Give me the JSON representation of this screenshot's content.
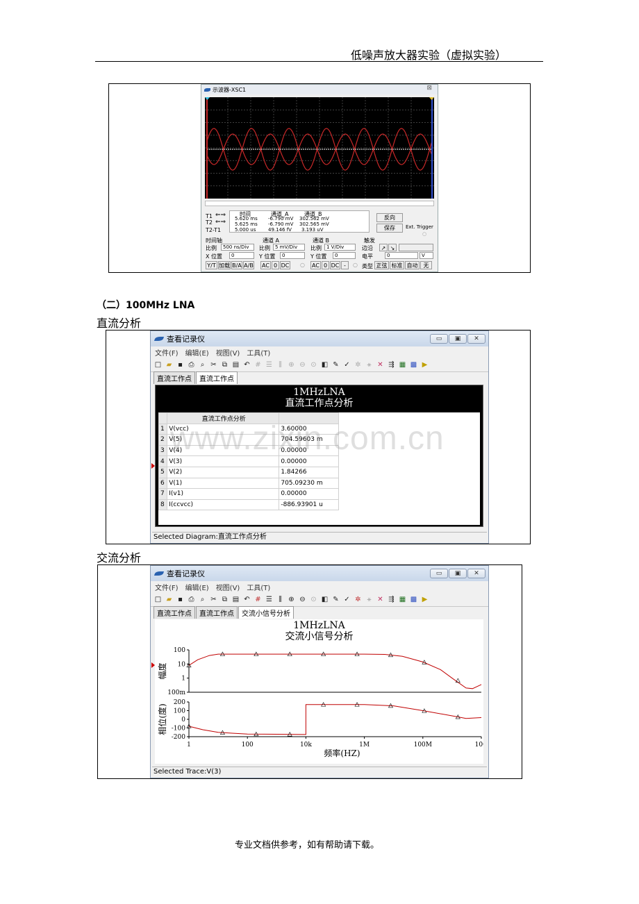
{
  "header": {
    "title": "低噪声放大器实验（虚拟实验）"
  },
  "scope": {
    "title": "示波器-XSC1",
    "close": "⊠",
    "col_headers": [
      "时间",
      "通道_A",
      "通道_B"
    ],
    "rows": [
      {
        "label": "T1",
        "time": "5.620 ms",
        "a": "-6.790 mV",
        "b": "302.562 mV"
      },
      {
        "label": "T2",
        "time": "5.625 ms",
        "a": "-6.790 mV",
        "b": "302.565 mV"
      },
      {
        "label": "T2-T1",
        "time": "5.000 us",
        "a": "49.146 fV",
        "b": "3.193 uV"
      }
    ],
    "reverse": "反向",
    "save": "保存",
    "ext_trigger": "Ext. Trigger",
    "timebase": {
      "title": "时间轴",
      "scale_label": "比例",
      "scale": "500 ns/Div",
      "pos_label": "X 位置",
      "pos": "0",
      "buttons": [
        "Y/T",
        "加载",
        "B/A",
        "A/B"
      ]
    },
    "chA": {
      "title": "通道 A",
      "scale_label": "比例",
      "scale": "5 mV/Div",
      "pos_label": "Y 位置",
      "pos": "0",
      "buttons": [
        "AC",
        "0",
        "DC"
      ]
    },
    "chB": {
      "title": "通道 B",
      "scale_label": "比例",
      "scale": "1 V/Div",
      "pos_label": "Y 位置",
      "pos": "0",
      "buttons": [
        "AC",
        "0",
        "DC",
        "-"
      ]
    },
    "trigger": {
      "title": "触发",
      "edge_label": "边沿",
      "level_label": "电平",
      "level": "0",
      "level_unit": "V",
      "type_label": "类型",
      "buttons": [
        "正弦",
        "标准",
        "自动",
        "无"
      ]
    }
  },
  "section": {
    "title": "（二）100MHz LNA",
    "dc_label": "直流分析",
    "ac_label": "交流分析"
  },
  "grapher": {
    "title": "查看记录仪",
    "menu": [
      "文件(F)",
      "编辑(E)",
      "视图(V)",
      "工具(T)"
    ],
    "min": "▭",
    "max": "▣",
    "close": "✕"
  },
  "dc": {
    "tabs": [
      "直流工作点",
      "直流工作点"
    ],
    "chart_title": "1MHzLNA",
    "chart_sub": "直流工作点分析",
    "col_header": "直流工作点分析",
    "rows": [
      {
        "n": "1",
        "name": "V(vcc)",
        "val": "3.60000"
      },
      {
        "n": "2",
        "name": "V(5)",
        "val": "704.59603 m"
      },
      {
        "n": "3",
        "name": "V(4)",
        "val": "0.00000"
      },
      {
        "n": "4",
        "name": "V(3)",
        "val": "0.00000"
      },
      {
        "n": "5",
        "name": "V(2)",
        "val": "1.84266"
      },
      {
        "n": "6",
        "name": "V(1)",
        "val": "705.09230 m"
      },
      {
        "n": "7",
        "name": "I(v1)",
        "val": "0.00000"
      },
      {
        "n": "8",
        "name": "I(ccvcc)",
        "val": "-886.93901 u"
      }
    ],
    "status": "Selected Diagram:直流工作点分析"
  },
  "ac": {
    "tabs": [
      "直流工作点",
      "直流工作点",
      "交流小信号分析"
    ],
    "chart_title": "1MHzLNA",
    "chart_sub": "交流小信号分析",
    "status": "Selected Trace:V(3)"
  },
  "chart_data": [
    {
      "type": "line",
      "title": "1MHzLNA",
      "subtitle": "交流小信号分析",
      "ylabel": "幅度",
      "xlabel": "频率(HZ)",
      "x_scale": "log",
      "y_scale": "log",
      "x_ticks": [
        "1",
        "100",
        "10k",
        "1M",
        "100M",
        "10G"
      ],
      "y_ticks": [
        "100",
        "10",
        "1",
        "100m"
      ],
      "xlim": [
        1,
        10000000000
      ],
      "ylim": [
        0.1,
        100
      ],
      "color": "#c00000",
      "x": [
        1,
        2,
        5,
        10,
        30,
        100,
        1000,
        10000,
        100000,
        1000000,
        5000000,
        20000000,
        100000000,
        400000000,
        1000000000,
        3000000000,
        5000000000,
        10000000000
      ],
      "y": [
        8,
        20,
        40,
        50,
        50,
        50,
        50,
        50,
        50,
        50,
        48,
        35,
        14,
        4,
        1,
        0.2,
        0.18,
        0.35
      ]
    },
    {
      "type": "line",
      "ylabel": "相位(度)",
      "xlabel": "频率(HZ)",
      "x_scale": "log",
      "y_ticks": [
        "200",
        "100",
        "0",
        "-100",
        "-200"
      ],
      "xlim": [
        1,
        10000000000
      ],
      "ylim": [
        -200,
        200
      ],
      "color": "#c00000",
      "x": [
        1,
        3,
        10,
        30,
        100,
        1000,
        10000,
        10001,
        100000,
        1000000,
        10000000,
        100000000,
        1000000000,
        3000000000,
        10000000000
      ],
      "y": [
        -80,
        -120,
        -150,
        -160,
        -170,
        -172,
        -175,
        170,
        170,
        170,
        155,
        100,
        40,
        10,
        20
      ]
    }
  ],
  "footer": {
    "text": "专业文档供参考，如有帮助请下载。"
  },
  "watermark": {
    "text": "www.zixin.com.cn"
  }
}
